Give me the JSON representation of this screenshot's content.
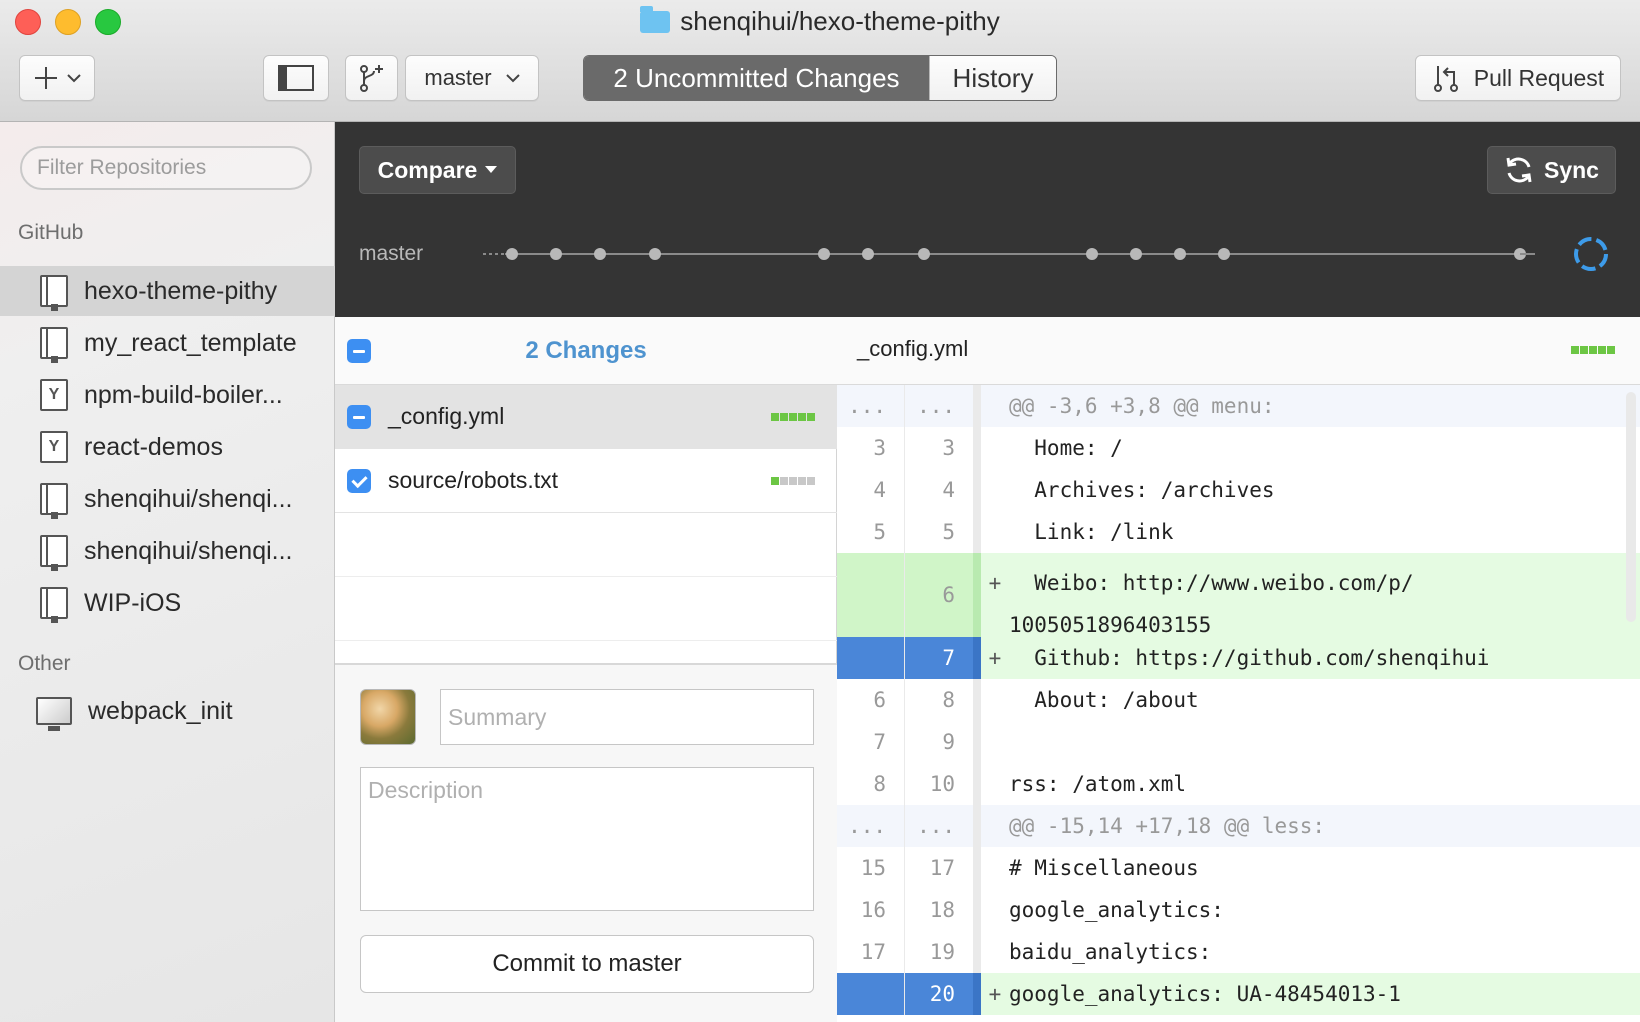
{
  "window": {
    "title": "shenqihui/hexo-theme-pithy"
  },
  "toolbar": {
    "add_icon": "plus-icon",
    "branch_name": "master",
    "uncommitted_label": "2 Uncommitted Changes",
    "history_label": "History",
    "pull_request_label": "Pull Request"
  },
  "sidebar": {
    "filter_placeholder": "Filter Repositories",
    "github_heading": "GitHub",
    "other_heading": "Other",
    "repos": [
      {
        "label": "hexo-theme-pithy",
        "icon": "repo-icon",
        "selected": true
      },
      {
        "label": "my_react_template",
        "icon": "repo-icon"
      },
      {
        "label": "npm-build-boiler...",
        "icon": "fork-icon"
      },
      {
        "label": "react-demos",
        "icon": "fork-icon"
      },
      {
        "label": "shenqihui/shenqi...",
        "icon": "repo-icon"
      },
      {
        "label": "shenqihui/shenqi...",
        "icon": "repo-icon"
      },
      {
        "label": "WIP-iOS",
        "icon": "repo-icon"
      }
    ],
    "other_repos": [
      {
        "label": "webpack_init",
        "icon": "monitor-icon"
      }
    ]
  },
  "timeline": {
    "compare_label": "Compare",
    "sync_label": "Sync",
    "branch_label": "master"
  },
  "changes": {
    "count_label": "2 Changes",
    "files": [
      {
        "name": "_config.yml",
        "checked": "partial",
        "selected": true
      },
      {
        "name": "source/robots.txt",
        "checked": "full",
        "selected": false
      }
    ],
    "summary_placeholder": "Summary",
    "description_placeholder": "Description",
    "commit_label": "Commit to master"
  },
  "diff": {
    "file_name": "_config.yml",
    "lines": [
      {
        "type": "hunk",
        "old": "...",
        "new": "...",
        "mark": "",
        "code": "@@ -3,6 +3,8 @@ menu:"
      },
      {
        "type": "ctx",
        "old": "3",
        "new": "3",
        "mark": "",
        "code": "  Home: /"
      },
      {
        "type": "ctx",
        "old": "4",
        "new": "4",
        "mark": "",
        "code": "  Archives: /archives"
      },
      {
        "type": "ctx",
        "old": "5",
        "new": "5",
        "mark": "",
        "code": "  Link: /link"
      },
      {
        "type": "add",
        "old": "",
        "new": "6",
        "mark": "+",
        "code": "  Weibo: http://www.weibo.com/p/\n1005051896403155"
      },
      {
        "type": "add-sel",
        "old": "",
        "new": "7",
        "mark": "+",
        "code": "  Github: https://github.com/shenqihui"
      },
      {
        "type": "ctx",
        "old": "6",
        "new": "8",
        "mark": "",
        "code": "  About: /about"
      },
      {
        "type": "ctx",
        "old": "7",
        "new": "9",
        "mark": "",
        "code": ""
      },
      {
        "type": "ctx",
        "old": "8",
        "new": "10",
        "mark": "",
        "code": "rss: /atom.xml"
      },
      {
        "type": "hunk",
        "old": "...",
        "new": "...",
        "mark": "",
        "code": "@@ -15,14 +17,18 @@ less:"
      },
      {
        "type": "ctx",
        "old": "15",
        "new": "17",
        "mark": "",
        "code": "# Miscellaneous"
      },
      {
        "type": "ctx",
        "old": "16",
        "new": "18",
        "mark": "",
        "code": "google_analytics:"
      },
      {
        "type": "ctx",
        "old": "17",
        "new": "19",
        "mark": "",
        "code": "baidu_analytics:"
      },
      {
        "type": "add-sel",
        "old": "",
        "new": "20",
        "mark": "+",
        "code": "google_analytics: UA-48454013-1"
      }
    ]
  },
  "colors": {
    "accent": "#3d8ff2",
    "added": "#6cc644",
    "dark_bg": "#343434"
  }
}
